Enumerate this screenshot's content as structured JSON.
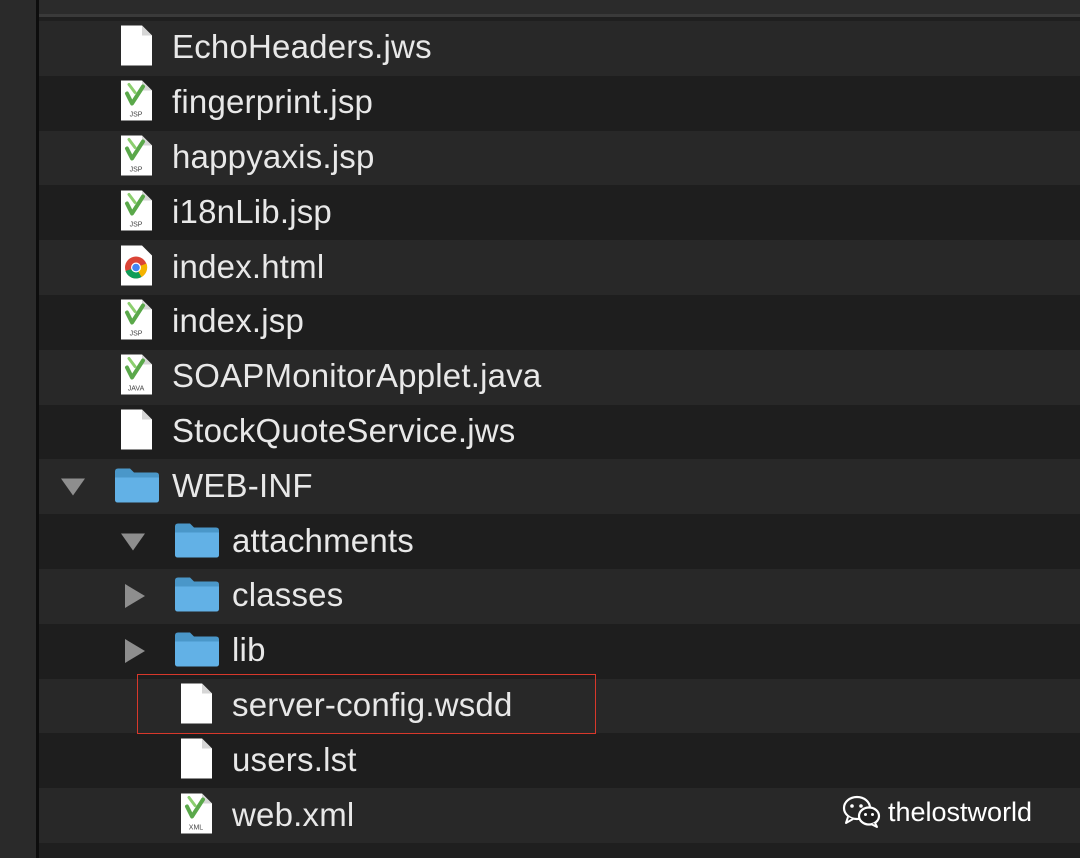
{
  "files": [
    {
      "name": "EchoHeaders.jws",
      "icon": "document-icon",
      "indent": 0
    },
    {
      "name": "fingerprint.jsp",
      "icon": "jsp-file-icon",
      "indent": 0,
      "badge": "JSP"
    },
    {
      "name": "happyaxis.jsp",
      "icon": "jsp-file-icon",
      "indent": 0,
      "badge": "JSP"
    },
    {
      "name": "i18nLib.jsp",
      "icon": "jsp-file-icon",
      "indent": 0,
      "badge": "JSP"
    },
    {
      "name": "index.html",
      "icon": "chrome-html-icon",
      "indent": 0
    },
    {
      "name": "index.jsp",
      "icon": "jsp-file-icon",
      "indent": 0,
      "badge": "JSP"
    },
    {
      "name": "SOAPMonitorApplet.java",
      "icon": "java-file-icon",
      "indent": 0,
      "badge": "JAVA"
    },
    {
      "name": "StockQuoteService.jws",
      "icon": "document-icon",
      "indent": 0
    },
    {
      "name": "WEB-INF",
      "icon": "folder-icon",
      "indent": 0,
      "disclosure": "expanded"
    },
    {
      "name": "attachments",
      "icon": "folder-icon",
      "indent": 1,
      "disclosure": "expanded"
    },
    {
      "name": "classes",
      "icon": "folder-icon",
      "indent": 1,
      "disclosure": "collapsed"
    },
    {
      "name": "lib",
      "icon": "folder-icon",
      "indent": 1,
      "disclosure": "collapsed"
    },
    {
      "name": "server-config.wsdd",
      "icon": "document-icon",
      "indent": 1,
      "highlighted": true
    },
    {
      "name": "users.lst",
      "icon": "document-icon",
      "indent": 1
    },
    {
      "name": "web.xml",
      "icon": "xml-file-icon",
      "indent": 1,
      "badge": "XML"
    }
  ],
  "watermark": {
    "text": "thelostworld",
    "icon": "wechat-icon"
  },
  "colors": {
    "highlight_border": "#d8382b",
    "folder": "#5aa9de",
    "text": "#e8e8e8"
  }
}
